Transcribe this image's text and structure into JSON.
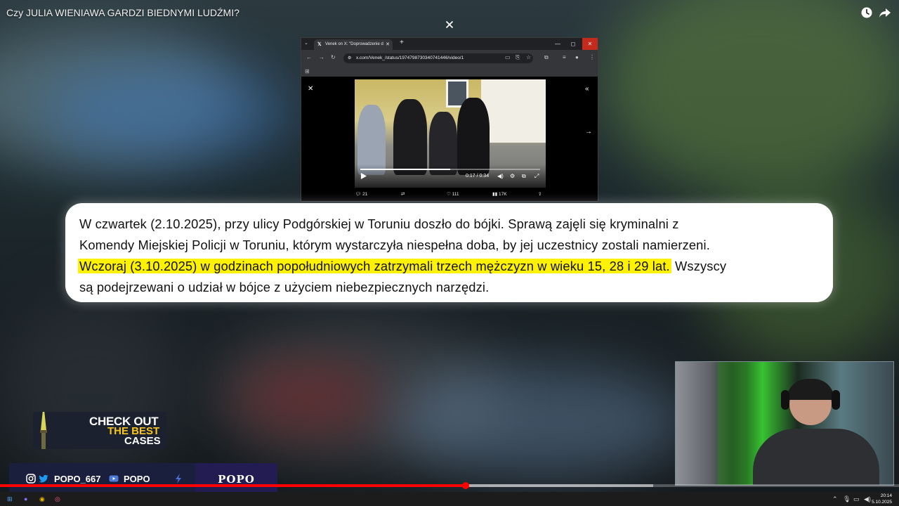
{
  "video": {
    "title": "Czy JULIA WIENIAWA GARDZI BIEDNYMI LUDŹMI?",
    "progress_fraction": 0.519
  },
  "browser": {
    "tab_title": "Venek on X: \"Doprowadzenie d",
    "url": "x.com/Venek_/status/1974798730340741446/video/1",
    "new_tab": "+",
    "controls": {
      "minimize": "—",
      "maximize": "◻",
      "close": "✕"
    }
  },
  "tweet_video": {
    "time": "0:17 / 0:34",
    "progress_fraction": 0.5
  },
  "tweet_actions": {
    "replies": "21",
    "likes": "111",
    "views": "17K"
  },
  "quote": {
    "line1": "W czwartek (2.10.2025), przy ulicy Podgórskiej w Toruniu doszło do bójki. Sprawą zajęli się kryminalni z",
    "line2": "Komendy Miejskiej Policji w Toruniu, którym wystarczyła niespełna doba, by jej uczestnicy zostali namierzeni.",
    "line3_highlight": "Wczoraj (3.10.2025) w godzinach popołudniowych zatrzymali trzech mężczyzn w wieku 15, 28 i 29 lat.",
    "line3_rest": " Wszyscy",
    "line4": "są podejrzewani o udział w bójce z użyciem niebezpiecznych narzędzi.",
    "highlight_color": "#fff200"
  },
  "promo": {
    "line1": "CHECK OUT",
    "line2": "THE BEST",
    "line3": "CASES"
  },
  "socials": {
    "instagram_twitter_handle": "POPO_667",
    "youtube_handle": "POPO",
    "brand": "POPO"
  },
  "taskbar": {
    "time": "20:14",
    "date": "5.10.2025"
  },
  "icons": [
    "watch-later-icon",
    "share-icon",
    "close-icon",
    "play-icon",
    "volume-icon",
    "settings-icon",
    "fullscreen-icon",
    "reply-icon",
    "retweet-icon",
    "like-icon",
    "views-icon",
    "share-tweet-icon",
    "instagram-icon",
    "twitter-icon",
    "youtube-icon",
    "windows-start-icon"
  ]
}
